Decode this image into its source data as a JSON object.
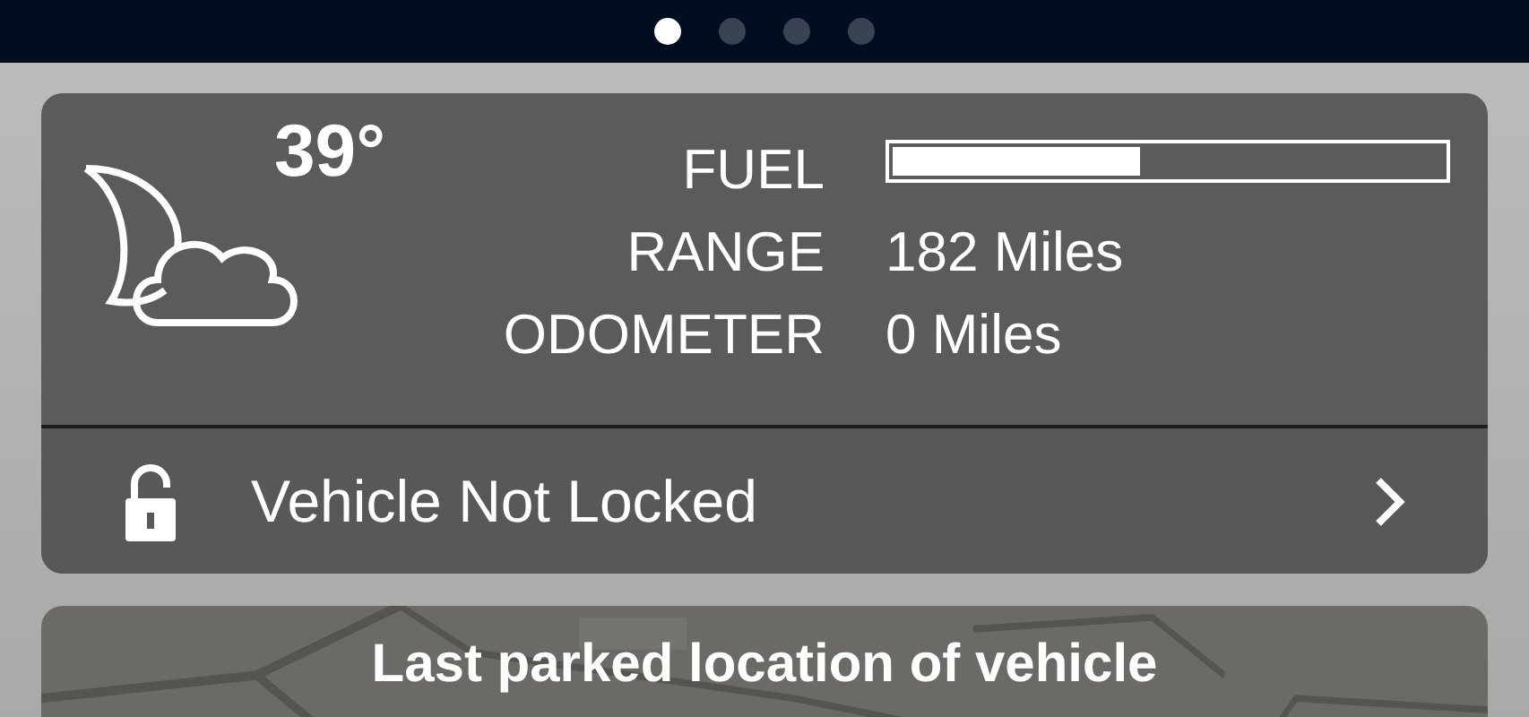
{
  "page_dots": [
    {
      "selected": true
    },
    {
      "selected": false
    },
    {
      "selected": false
    },
    {
      "selected": false
    }
  ],
  "status_card": {
    "temperature": "39°",
    "stats": [
      {
        "kind": "bar",
        "label": "FUEL",
        "level": 0.45
      },
      {
        "kind": "text",
        "label": "RANGE",
        "value": "182 Miles"
      },
      {
        "kind": "text",
        "label": "ODOMETER",
        "value": "0 Miles"
      }
    ],
    "lock": {
      "label": "Vehicle Not Locked",
      "locked": false
    }
  },
  "location_card": {
    "title": "Last parked location of vehicle"
  }
}
